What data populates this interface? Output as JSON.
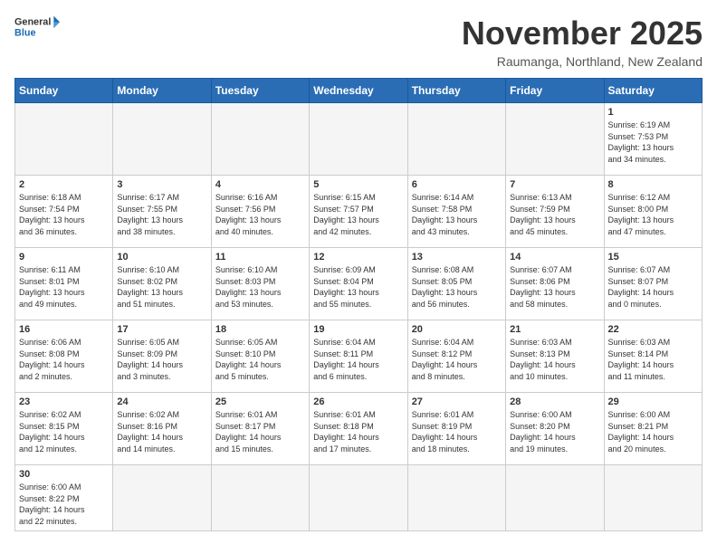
{
  "header": {
    "logo_general": "General",
    "logo_blue": "Blue",
    "month_title": "November 2025",
    "location": "Raumanga, Northland, New Zealand"
  },
  "weekdays": [
    "Sunday",
    "Monday",
    "Tuesday",
    "Wednesday",
    "Thursday",
    "Friday",
    "Saturday"
  ],
  "weeks": [
    [
      {
        "day": "",
        "info": ""
      },
      {
        "day": "",
        "info": ""
      },
      {
        "day": "",
        "info": ""
      },
      {
        "day": "",
        "info": ""
      },
      {
        "day": "",
        "info": ""
      },
      {
        "day": "",
        "info": ""
      },
      {
        "day": "1",
        "info": "Sunrise: 6:19 AM\nSunset: 7:53 PM\nDaylight: 13 hours\nand 34 minutes."
      }
    ],
    [
      {
        "day": "2",
        "info": "Sunrise: 6:18 AM\nSunset: 7:54 PM\nDaylight: 13 hours\nand 36 minutes."
      },
      {
        "day": "3",
        "info": "Sunrise: 6:17 AM\nSunset: 7:55 PM\nDaylight: 13 hours\nand 38 minutes."
      },
      {
        "day": "4",
        "info": "Sunrise: 6:16 AM\nSunset: 7:56 PM\nDaylight: 13 hours\nand 40 minutes."
      },
      {
        "day": "5",
        "info": "Sunrise: 6:15 AM\nSunset: 7:57 PM\nDaylight: 13 hours\nand 42 minutes."
      },
      {
        "day": "6",
        "info": "Sunrise: 6:14 AM\nSunset: 7:58 PM\nDaylight: 13 hours\nand 43 minutes."
      },
      {
        "day": "7",
        "info": "Sunrise: 6:13 AM\nSunset: 7:59 PM\nDaylight: 13 hours\nand 45 minutes."
      },
      {
        "day": "8",
        "info": "Sunrise: 6:12 AM\nSunset: 8:00 PM\nDaylight: 13 hours\nand 47 minutes."
      }
    ],
    [
      {
        "day": "9",
        "info": "Sunrise: 6:11 AM\nSunset: 8:01 PM\nDaylight: 13 hours\nand 49 minutes."
      },
      {
        "day": "10",
        "info": "Sunrise: 6:10 AM\nSunset: 8:02 PM\nDaylight: 13 hours\nand 51 minutes."
      },
      {
        "day": "11",
        "info": "Sunrise: 6:10 AM\nSunset: 8:03 PM\nDaylight: 13 hours\nand 53 minutes."
      },
      {
        "day": "12",
        "info": "Sunrise: 6:09 AM\nSunset: 8:04 PM\nDaylight: 13 hours\nand 55 minutes."
      },
      {
        "day": "13",
        "info": "Sunrise: 6:08 AM\nSunset: 8:05 PM\nDaylight: 13 hours\nand 56 minutes."
      },
      {
        "day": "14",
        "info": "Sunrise: 6:07 AM\nSunset: 8:06 PM\nDaylight: 13 hours\nand 58 minutes."
      },
      {
        "day": "15",
        "info": "Sunrise: 6:07 AM\nSunset: 8:07 PM\nDaylight: 14 hours\nand 0 minutes."
      }
    ],
    [
      {
        "day": "16",
        "info": "Sunrise: 6:06 AM\nSunset: 8:08 PM\nDaylight: 14 hours\nand 2 minutes."
      },
      {
        "day": "17",
        "info": "Sunrise: 6:05 AM\nSunset: 8:09 PM\nDaylight: 14 hours\nand 3 minutes."
      },
      {
        "day": "18",
        "info": "Sunrise: 6:05 AM\nSunset: 8:10 PM\nDaylight: 14 hours\nand 5 minutes."
      },
      {
        "day": "19",
        "info": "Sunrise: 6:04 AM\nSunset: 8:11 PM\nDaylight: 14 hours\nand 6 minutes."
      },
      {
        "day": "20",
        "info": "Sunrise: 6:04 AM\nSunset: 8:12 PM\nDaylight: 14 hours\nand 8 minutes."
      },
      {
        "day": "21",
        "info": "Sunrise: 6:03 AM\nSunset: 8:13 PM\nDaylight: 14 hours\nand 10 minutes."
      },
      {
        "day": "22",
        "info": "Sunrise: 6:03 AM\nSunset: 8:14 PM\nDaylight: 14 hours\nand 11 minutes."
      }
    ],
    [
      {
        "day": "23",
        "info": "Sunrise: 6:02 AM\nSunset: 8:15 PM\nDaylight: 14 hours\nand 12 minutes."
      },
      {
        "day": "24",
        "info": "Sunrise: 6:02 AM\nSunset: 8:16 PM\nDaylight: 14 hours\nand 14 minutes."
      },
      {
        "day": "25",
        "info": "Sunrise: 6:01 AM\nSunset: 8:17 PM\nDaylight: 14 hours\nand 15 minutes."
      },
      {
        "day": "26",
        "info": "Sunrise: 6:01 AM\nSunset: 8:18 PM\nDaylight: 14 hours\nand 17 minutes."
      },
      {
        "day": "27",
        "info": "Sunrise: 6:01 AM\nSunset: 8:19 PM\nDaylight: 14 hours\nand 18 minutes."
      },
      {
        "day": "28",
        "info": "Sunrise: 6:00 AM\nSunset: 8:20 PM\nDaylight: 14 hours\nand 19 minutes."
      },
      {
        "day": "29",
        "info": "Sunrise: 6:00 AM\nSunset: 8:21 PM\nDaylight: 14 hours\nand 20 minutes."
      }
    ],
    [
      {
        "day": "30",
        "info": "Sunrise: 6:00 AM\nSunset: 8:22 PM\nDaylight: 14 hours\nand 22 minutes."
      },
      {
        "day": "",
        "info": ""
      },
      {
        "day": "",
        "info": ""
      },
      {
        "day": "",
        "info": ""
      },
      {
        "day": "",
        "info": ""
      },
      {
        "day": "",
        "info": ""
      },
      {
        "day": "",
        "info": ""
      }
    ]
  ]
}
